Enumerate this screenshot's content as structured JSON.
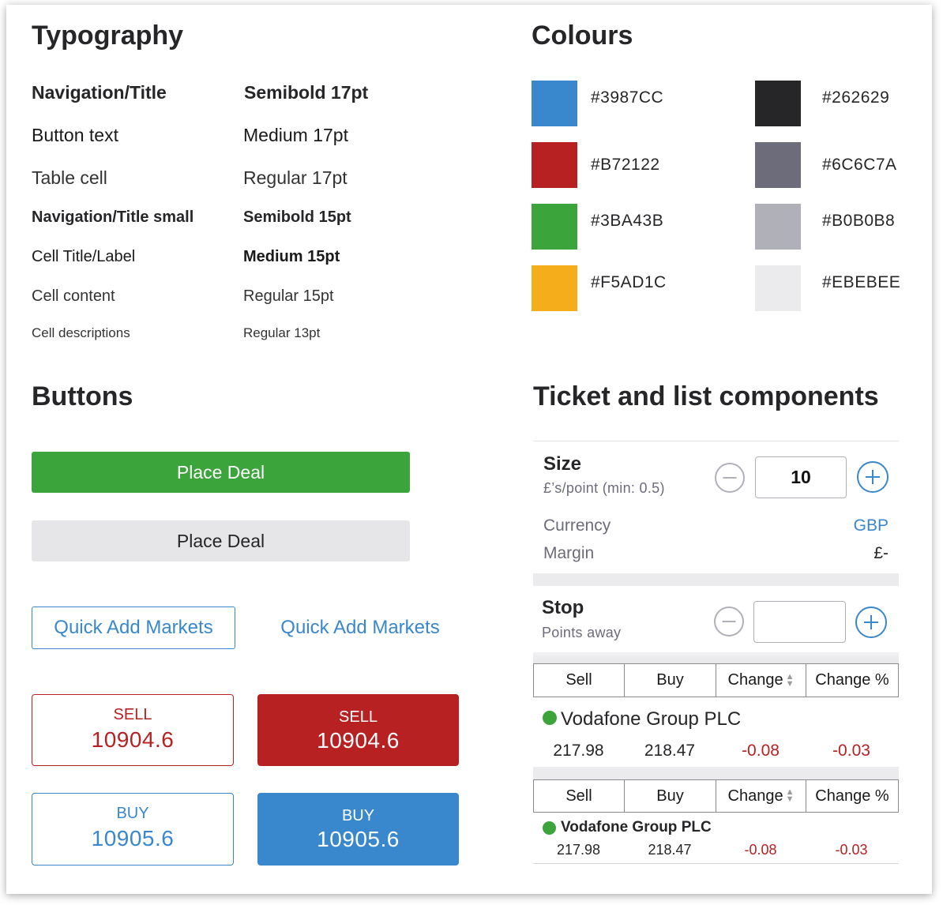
{
  "typography": {
    "title": "Typography",
    "rows": [
      {
        "label": "Navigation/Title",
        "value": "Semibold 17pt"
      },
      {
        "label": "Button text",
        "value": "Medium 17pt"
      },
      {
        "label": "Table cell",
        "value": "Regular 17pt"
      },
      {
        "label": "Navigation/Title small",
        "value": "Semibold 15pt"
      },
      {
        "label": "Cell Title/Label",
        "value": "Medium 15pt"
      },
      {
        "label": "Cell content",
        "value": "Regular 15pt"
      },
      {
        "label": "Cell descriptions",
        "value": "Regular 13pt"
      }
    ]
  },
  "colours": {
    "title": "Colours",
    "swatches": [
      {
        "hex": "#3987CC"
      },
      {
        "hex": "#262629"
      },
      {
        "hex": "#B72122"
      },
      {
        "hex": "#6C6C7A"
      },
      {
        "hex": "#3BA43B"
      },
      {
        "hex": "#B0B0B8"
      },
      {
        "hex": "#F5AD1C"
      },
      {
        "hex": "#EBEBEE"
      }
    ]
  },
  "buttons": {
    "title": "Buttons",
    "place_deal_primary": "Place Deal",
    "place_deal_disabled": "Place Deal",
    "quick_add_outlined": "Quick Add Markets",
    "quick_add_text": "Quick Add Markets",
    "sell_outline": {
      "label": "SELL",
      "value": "10904.6"
    },
    "sell_filled": {
      "label": "SELL",
      "value": "10904.6"
    },
    "buy_outline": {
      "label": "BUY",
      "value": "10905.6"
    },
    "buy_filled": {
      "label": "BUY",
      "value": "10905.6"
    }
  },
  "ticket": {
    "title": "Ticket and list components",
    "size": {
      "title": "Size",
      "subtitle": "£’s/point (min: 0.5)",
      "value": "10"
    },
    "currency": {
      "label": "Currency",
      "value": "GBP"
    },
    "margin": {
      "label": "Margin",
      "value": "£-"
    },
    "stop": {
      "title": "Stop",
      "subtitle": "Points away",
      "value": ""
    },
    "table_large": {
      "headers": [
        "Sell",
        "Buy",
        "Change",
        "Change %"
      ],
      "market": "Vodafone Group PLC",
      "sell": "217.98",
      "buy": "218.47",
      "change": "-0.08",
      "change_pct": "-0.03"
    },
    "table_small": {
      "headers": [
        "Sell",
        "Buy",
        "Change",
        "Change %"
      ],
      "market": "Vodafone Group PLC",
      "sell": "217.98",
      "buy": "218.47",
      "change": "-0.08",
      "change_pct": "-0.03"
    }
  }
}
